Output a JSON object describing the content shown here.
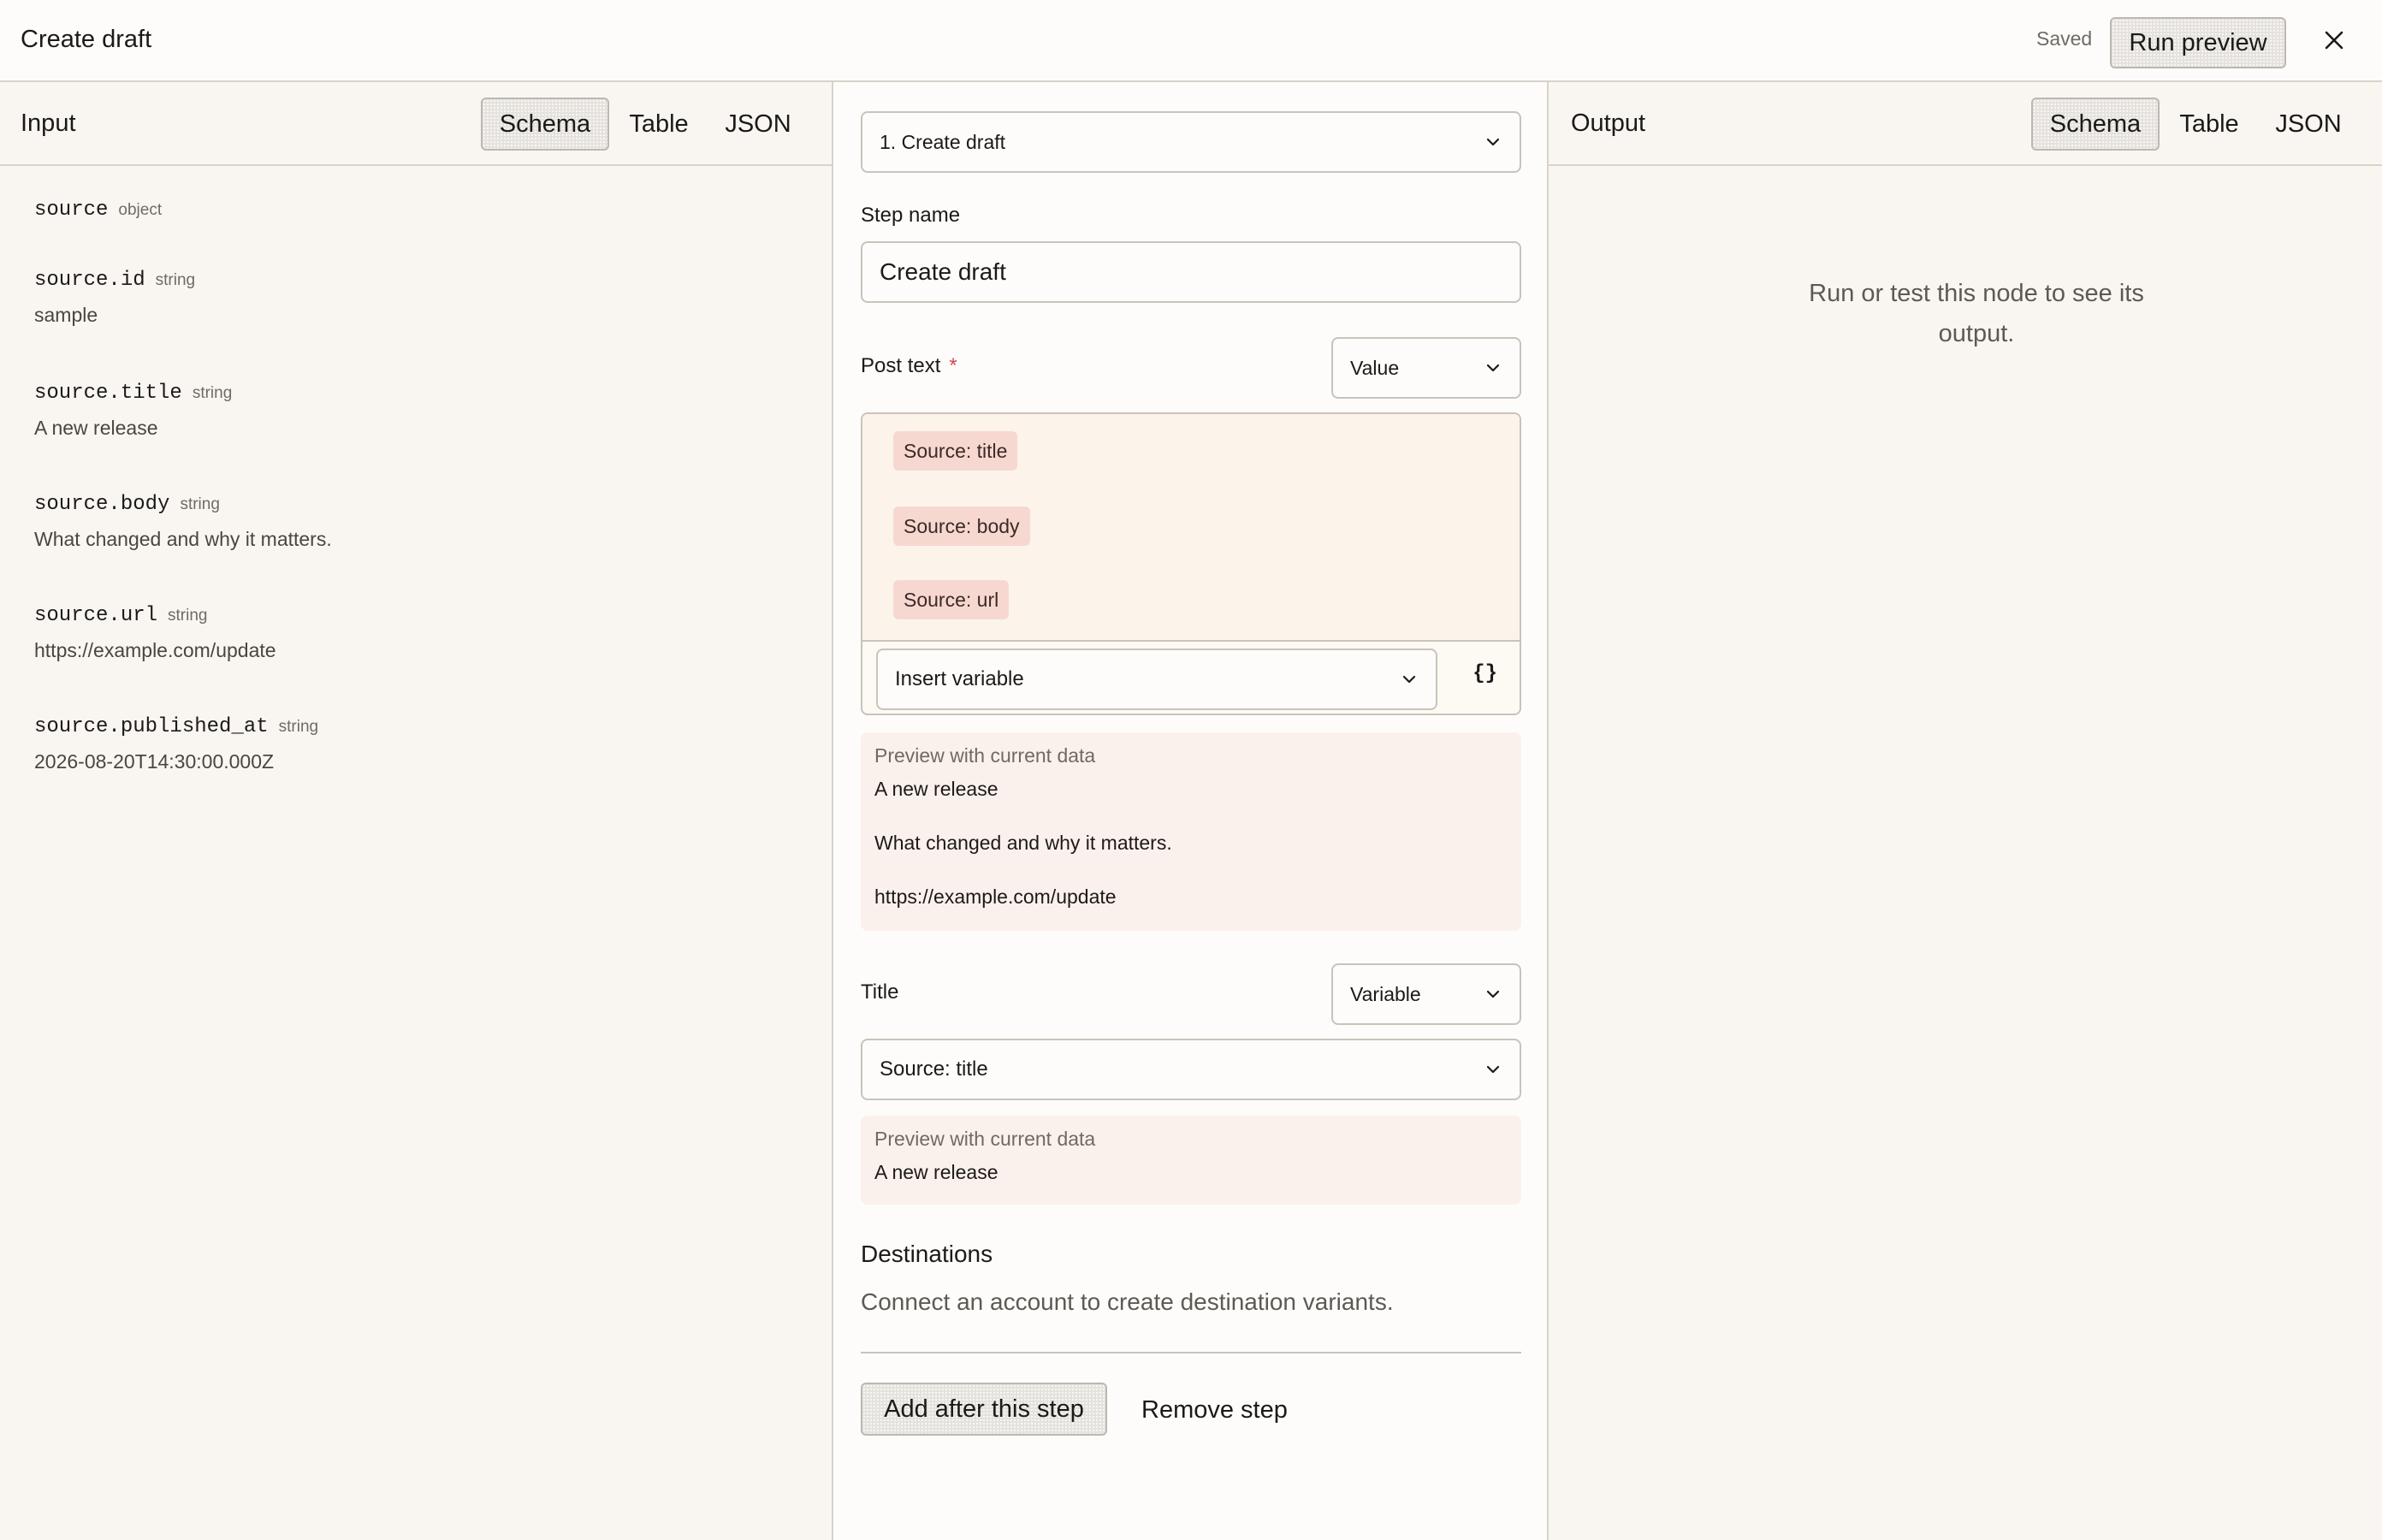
{
  "header": {
    "title": "Create draft",
    "status": "Saved",
    "run_label": "Run preview"
  },
  "input": {
    "label": "Input",
    "tabs": [
      "Schema",
      "Table",
      "JSON"
    ],
    "active_tab": "Schema",
    "fields": [
      {
        "name": "source",
        "type": "object",
        "value": ""
      },
      {
        "name": "source.id",
        "type": "string",
        "value": "sample"
      },
      {
        "name": "source.title",
        "type": "string",
        "value": "A new release"
      },
      {
        "name": "source.body",
        "type": "string",
        "value": "What changed and why it matters."
      },
      {
        "name": "source.url",
        "type": "string",
        "value": "https://example.com/update"
      },
      {
        "name": "source.published_at",
        "type": "string",
        "value": "2026-08-20T14:30:00.000Z"
      }
    ]
  },
  "step": {
    "selector": "1. Create draft",
    "name_label": "Step name",
    "name_value": "Create draft",
    "post_text": {
      "label": "Post text",
      "required_mark": "*",
      "mode": "Value",
      "tokens": [
        "Source: title",
        "Source: body",
        "Source: url"
      ],
      "insert_placeholder": "Insert variable",
      "braces": "{}",
      "preview_label": "Preview with current data",
      "preview_lines": [
        "A new release",
        "What changed and why it matters.",
        "https://example.com/update"
      ]
    },
    "title_field": {
      "label": "Title",
      "mode": "Variable",
      "selected": "Source: title",
      "preview_label": "Preview with current data",
      "preview_value": "A new release"
    },
    "destinations": {
      "heading": "Destinations",
      "text": "Connect an account to create destination variants."
    },
    "add_label": "Add after this step",
    "remove_label": "Remove step"
  },
  "output": {
    "label": "Output",
    "tabs": [
      "Schema",
      "Table",
      "JSON"
    ],
    "active_tab": "Schema",
    "empty_text": "Run or test this node to see its output."
  },
  "icons": [
    "close-icon",
    "chevron-down-icon",
    "braces-icon"
  ],
  "colors": {
    "background": "#f9f6f1",
    "chip": "#f7d8d0",
    "preview": "#fbf1ec",
    "required": "#d04a4a"
  }
}
